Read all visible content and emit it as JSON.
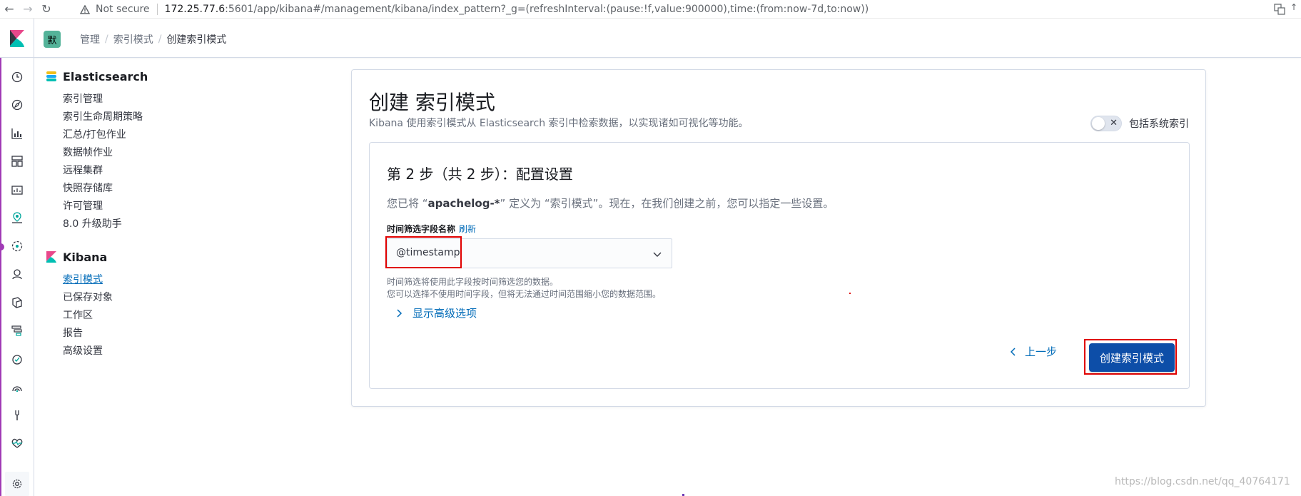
{
  "browser": {
    "not_secure": "Not secure",
    "url_host": "172.25.77.6",
    "url_rest": ":5601/app/kibana#/management/kibana/index_pattern?_g=(refreshInterval:(pause:!f,value:900000),time:(from:now-7d,to:now))"
  },
  "header": {
    "space_initial": "默",
    "breadcrumbs": [
      "管理",
      "索引模式",
      "创建索引模式"
    ]
  },
  "sidebar": {
    "elasticsearch": {
      "title": "Elasticsearch",
      "items": [
        "索引管理",
        "索引生命周期策略",
        "汇总/打包作业",
        "数据帧作业",
        "远程集群",
        "快照存储库",
        "许可管理",
        "8.0 升级助手"
      ]
    },
    "kibana": {
      "title": "Kibana",
      "items": [
        "索引模式",
        "已保存对象",
        "工作区",
        "报告",
        "高级设置"
      ]
    }
  },
  "main": {
    "title": "创建 索引模式",
    "subtitle": "Kibana 使用索引模式从 Elasticsearch 索引中检索数据，以实现诸如可视化等功能。",
    "include_system_label": "包括系统索引",
    "step": {
      "title": "第 2 步（共 2 步）：配置设置",
      "desc_prefix": "您已将 “",
      "desc_pattern": "apachelog-*",
      "desc_suffix": "” 定义为 “索引模式”。现在，在我们创建之前，您可以指定一些设置。",
      "field_label": "时间筛选字段名称",
      "refresh_label": "刷新",
      "select_value": "@timestamp",
      "help_1": "时间筛选将使用此字段按时间筛选您的数据。",
      "help_2": "您可以选择不使用时间字段，但将无法通过时间范围缩小您的数据范围。",
      "advanced_label": "显示高级选项",
      "back_label": "上一步",
      "create_label": "创建索引模式"
    }
  },
  "watermark": "https://blog.csdn.net/qq_40764171",
  "colors": {
    "primary": "#0d4ea8",
    "link": "#006bb8",
    "highlight": "#e00000",
    "space_avatar": "#54b399"
  }
}
